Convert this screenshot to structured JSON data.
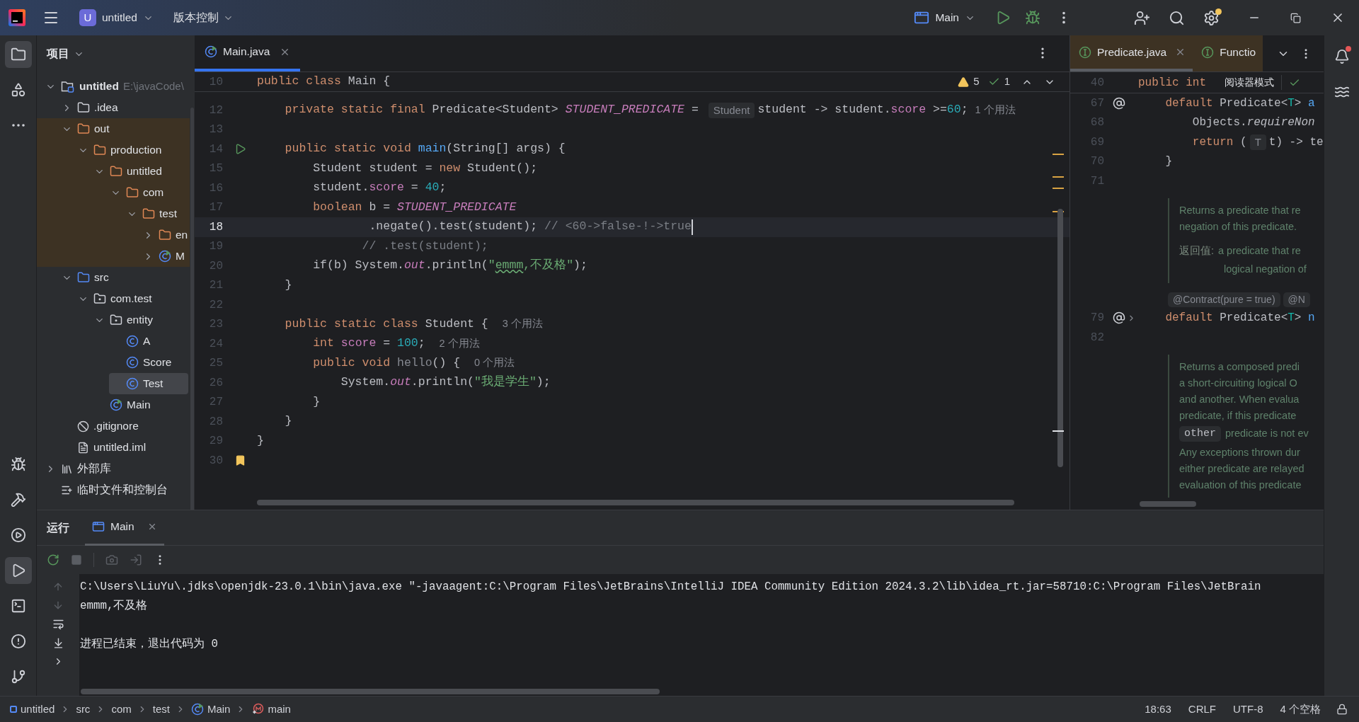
{
  "title_bar": {
    "project_badge": "U",
    "project": "untitled",
    "vcs": "版本控制",
    "run_config": "Main",
    "settings_badge": true
  },
  "left_toolbar": {
    "top": [
      {
        "kind": "project",
        "selected": true
      },
      {
        "kind": "structure",
        "selected": false
      },
      {
        "kind": "more",
        "selected": false
      }
    ],
    "bottom": [
      {
        "kind": "debug",
        "selected": false
      },
      {
        "kind": "build",
        "selected": false
      },
      {
        "kind": "services",
        "selected": false
      },
      {
        "kind": "run",
        "selected": true
      },
      {
        "kind": "terminal",
        "selected": false
      },
      {
        "kind": "problems",
        "selected": false
      },
      {
        "kind": "git",
        "selected": false
      }
    ]
  },
  "project_panel": {
    "title": "项目",
    "tree": [
      {
        "label": "untitled",
        "kind": "module",
        "path": "E:\\javaCode\\",
        "expanded": true,
        "selected": false,
        "children": [
          {
            "label": ".idea",
            "kind": "folder",
            "expanded": false,
            "selected": false
          },
          {
            "label": "out",
            "kind": "excluded",
            "expanded": true,
            "selected": false,
            "children": [
              {
                "label": "production",
                "kind": "excluded",
                "expanded": true,
                "selected": false,
                "children": [
                  {
                    "label": "untitled",
                    "kind": "excluded",
                    "expanded": true,
                    "selected": false,
                    "children": [
                      {
                        "label": "com",
                        "kind": "excluded",
                        "expanded": true,
                        "selected": false,
                        "children": [
                          {
                            "label": "test",
                            "kind": "excluded",
                            "expanded": true,
                            "selected": false,
                            "children": [
                              {
                                "label": "en",
                                "kind": "excluded",
                                "expanded": false,
                                "selected": false
                              },
                              {
                                "label": "M",
                                "kind": "main-class",
                                "expanded": false,
                                "selected": false
                              }
                            ]
                          }
                        ]
                      }
                    ]
                  }
                ]
              }
            ]
          },
          {
            "label": "src",
            "kind": "source",
            "expanded": true,
            "selected": false,
            "children": [
              {
                "label": "com.test",
                "kind": "package",
                "expanded": true,
                "selected": false,
                "children": [
                  {
                    "label": "entity",
                    "kind": "package",
                    "expanded": true,
                    "selected": false,
                    "children": [
                      {
                        "label": "A",
                        "kind": "class",
                        "selected": false
                      },
                      {
                        "label": "Score",
                        "kind": "class",
                        "selected": false
                      },
                      {
                        "label": "Test",
                        "kind": "class",
                        "selected": true
                      }
                    ]
                  },
                  {
                    "label": "Main",
                    "kind": "main-class",
                    "selected": false
                  }
                ]
              }
            ]
          },
          {
            "label": ".gitignore",
            "kind": "ignore",
            "selected": false
          },
          {
            "label": "untitled.iml",
            "kind": "iml",
            "selected": false
          }
        ]
      },
      {
        "label": "外部库",
        "kind": "library",
        "expanded": false,
        "selected": false
      },
      {
        "label": "临时文件和控制台",
        "kind": "scratch",
        "selected": false
      }
    ]
  },
  "editor": {
    "tabs": [
      {
        "label": "Main.java",
        "selected": true
      }
    ],
    "sticky": {
      "number": "10",
      "tokens": [
        {
          "kind": "kw",
          "text": "public class "
        },
        {
          "kind": "plain",
          "text": "Main {"
        }
      ]
    },
    "inspections": {
      "warnings": "5",
      "weak_warnings": "1"
    },
    "lines": [
      {
        "number": "12",
        "current": false,
        "tokens": [
          {
            "kind": "kw",
            "text": "    private static final "
          },
          {
            "kind": "plain",
            "text": "Predicate<Student> "
          },
          {
            "kind": "const",
            "text": "STUDENT_PREDICATE"
          },
          {
            "kind": "plain",
            "text": " = "
          },
          {
            "kind": "typehint",
            "text": "Student"
          },
          {
            "kind": "plain",
            "text": "student -> student."
          },
          {
            "kind": "field",
            "text": "score"
          },
          {
            "kind": "plain",
            "text": " >="
          },
          {
            "kind": "num",
            "text": "60"
          },
          {
            "kind": "plain",
            "text": ";"
          },
          {
            "kind": "hint",
            "text": "1 个用法"
          }
        ]
      },
      {
        "number": "13",
        "current": false
      },
      {
        "number": "14",
        "current": false,
        "kind": "run",
        "tokens": [
          {
            "kind": "kw",
            "text": "    public static void "
          },
          {
            "kind": "decl",
            "text": "main"
          },
          {
            "kind": "plain",
            "text": "(String[] args) {"
          }
        ]
      },
      {
        "number": "15",
        "current": false,
        "tokens": [
          {
            "kind": "plain",
            "text": "        Student student = "
          },
          {
            "kind": "kw",
            "text": "new "
          },
          {
            "kind": "plain",
            "text": "Student();"
          }
        ]
      },
      {
        "number": "16",
        "current": false,
        "tokens": [
          {
            "kind": "plain",
            "text": "        student."
          },
          {
            "kind": "field",
            "text": "score"
          },
          {
            "kind": "plain",
            "text": " = "
          },
          {
            "kind": "num",
            "text": "40"
          },
          {
            "kind": "plain",
            "text": ";"
          }
        ]
      },
      {
        "number": "17",
        "current": false,
        "tokens": [
          {
            "kind": "kw",
            "text": "        boolean "
          },
          {
            "kind": "plain",
            "text": "b = "
          },
          {
            "kind": "const",
            "text": "STUDENT_PREDICATE"
          }
        ]
      },
      {
        "number": "18",
        "current": true,
        "tokens": [
          {
            "kind": "plain",
            "text": "                .negate().test(student); "
          },
          {
            "kind": "comment",
            "text": "// <60->false-!->true"
          }
        ]
      },
      {
        "number": "19",
        "current": false,
        "tokens": [
          {
            "kind": "comment",
            "text": "               // .test(student);"
          }
        ]
      },
      {
        "number": "20",
        "current": false,
        "tokens": [
          {
            "kind": "plain",
            "text": "        if(b) System."
          },
          {
            "kind": "static",
            "text": "out"
          },
          {
            "kind": "plain",
            "text": ".println("
          },
          {
            "kind": "str",
            "text": "\""
          },
          {
            "kind": "typo",
            "text": "emmm"
          },
          {
            "kind": "str",
            "text": ",不及格\""
          },
          {
            "kind": "plain",
            "text": ");"
          }
        ]
      },
      {
        "number": "21",
        "current": false,
        "tokens": [
          {
            "kind": "plain",
            "text": "    }"
          }
        ]
      },
      {
        "number": "22",
        "current": false
      },
      {
        "number": "23",
        "current": false,
        "tokens": [
          {
            "kind": "kw",
            "text": "    public static class "
          },
          {
            "kind": "plain",
            "text": "Student { "
          },
          {
            "kind": "hint",
            "text": "3 个用法"
          }
        ]
      },
      {
        "number": "24",
        "current": false,
        "tokens": [
          {
            "kind": "kw",
            "text": "        int "
          },
          {
            "kind": "field",
            "text": "score"
          },
          {
            "kind": "plain",
            "text": " = "
          },
          {
            "kind": "num",
            "text": "100"
          },
          {
            "kind": "plain",
            "text": "; "
          },
          {
            "kind": "hint",
            "text": "2 个用法"
          }
        ]
      },
      {
        "number": "25",
        "current": false,
        "tokens": [
          {
            "kind": "kw",
            "text": "        public void "
          },
          {
            "kind": "unused",
            "text": "hello"
          },
          {
            "kind": "plain",
            "text": "() { "
          },
          {
            "kind": "hint",
            "text": "0 个用法"
          }
        ]
      },
      {
        "number": "26",
        "current": false,
        "tokens": [
          {
            "kind": "plain",
            "text": "            System."
          },
          {
            "kind": "static",
            "text": "out"
          },
          {
            "kind": "plain",
            "text": ".println("
          },
          {
            "kind": "str",
            "text": "\"我是学生\""
          },
          {
            "kind": "plain",
            "text": ");"
          }
        ]
      },
      {
        "number": "27",
        "current": false,
        "tokens": [
          {
            "kind": "plain",
            "text": "        }"
          }
        ]
      },
      {
        "number": "28",
        "current": false,
        "tokens": [
          {
            "kind": "plain",
            "text": "    }"
          }
        ]
      },
      {
        "number": "29",
        "current": false,
        "tokens": [
          {
            "kind": "plain",
            "text": "}"
          }
        ]
      },
      {
        "number": "30",
        "current": false,
        "kind": "bookmark"
      }
    ]
  },
  "side_editor": {
    "tabs": [
      {
        "label": "Predicate.java",
        "selected": true
      },
      {
        "label": "Functio",
        "selected": false
      }
    ],
    "sticky": {
      "number": "40",
      "tokens": [
        {
          "kind": "kw",
          "text": "public int"
        }
      ]
    },
    "reader_mode": "阅读器模式",
    "blocks": [
      {
        "kind": "code-at",
        "number": "67",
        "tokens": [
          {
            "kind": "kw",
            "text": "    default "
          },
          {
            "kind": "plain",
            "text": "Predicate<"
          },
          {
            "kind": "tparam",
            "text": "T"
          },
          {
            "kind": "plain",
            "text": "> "
          },
          {
            "kind": "decl",
            "text": "a"
          }
        ]
      },
      {
        "kind": "code",
        "number": "68",
        "tokens": [
          {
            "kind": "plain",
            "text": "        Objects."
          },
          {
            "kind": "ital",
            "text": "requireNon"
          }
        ]
      },
      {
        "kind": "code",
        "number": "69",
        "tokens": [
          {
            "kind": "kw",
            "text": "        return "
          },
          {
            "kind": "plain",
            "text": "("
          },
          {
            "kind": "typehint",
            "text": "T"
          },
          {
            "kind": "plain",
            "text": "t) -> te"
          }
        ]
      },
      {
        "kind": "code",
        "number": "70",
        "tokens": [
          {
            "kind": "plain",
            "text": "    }"
          }
        ]
      },
      {
        "kind": "code",
        "number": "71"
      },
      {
        "kind": "doc",
        "rows": [
          {
            "kind": "text",
            "text": "Returns a predicate that re"
          },
          {
            "kind": "text",
            "text": "negation of this predicate."
          },
          {
            "kind": "returns",
            "label": "返回值:",
            "text": "a predicate that re"
          },
          {
            "kind": "cont",
            "text": "logical negation of"
          }
        ]
      },
      {
        "kind": "annotations",
        "items": [
          "@Contract(pure = true)",
          "@N"
        ]
      },
      {
        "kind": "code-at-fold",
        "number": "79",
        "tokens": [
          {
            "kind": "kw",
            "text": "    default "
          },
          {
            "kind": "plain",
            "text": "Predicate<"
          },
          {
            "kind": "tparam",
            "text": "T"
          },
          {
            "kind": "plain",
            "text": "> "
          },
          {
            "kind": "decl",
            "text": "n"
          }
        ]
      },
      {
        "kind": "code",
        "number": "82"
      },
      {
        "kind": "doc",
        "rows": [
          {
            "kind": "text",
            "text": "Returns a composed predi"
          },
          {
            "kind": "text",
            "text": "a short-circuiting logical O"
          },
          {
            "kind": "text",
            "text": "and another. When evalua"
          },
          {
            "kind": "text",
            "text": "predicate, if this predicate"
          },
          {
            "kind": "code",
            "code": "other",
            "text": "predicate is not ev"
          },
          {
            "kind": "text",
            "text": "Any exceptions thrown dur"
          },
          {
            "kind": "text",
            "text": "either predicate are relayed"
          },
          {
            "kind": "text",
            "text": "evaluation of this predicate"
          }
        ]
      }
    ]
  },
  "run_panel": {
    "title": "运行",
    "tabs": [
      {
        "label": "Main",
        "selected": true
      }
    ],
    "output": [
      [
        "C:\\Users\\LiuYu\\.jdks\\openjdk-23.0.1\\bin\\java.exe \"-javaagent:C:\\Program Files\\JetBrains\\IntelliJ IDEA Community Edition 2024.3.2\\lib\\idea_rt.jar=58710:C:\\Program Files\\JetBrain",
        "emmm,不及格"
      ],
      [
        "进程已结束，退出代码为 0"
      ]
    ]
  },
  "right_toolbar": [
    {
      "kind": "notifications",
      "badge": true
    },
    {
      "kind": "ai",
      "badge": false
    }
  ],
  "status_bar": {
    "breadcrumbs": [
      {
        "label": "untitled",
        "kind": "module"
      },
      {
        "label": "src",
        "kind": "folder"
      },
      {
        "label": "com",
        "kind": "folder"
      },
      {
        "label": "test",
        "kind": "folder"
      },
      {
        "label": "Main",
        "kind": "main-class"
      },
      {
        "label": "main",
        "kind": "method"
      }
    ],
    "items": [
      "18:63",
      "CRLF",
      "UTF-8",
      "4 个空格"
    ]
  }
}
